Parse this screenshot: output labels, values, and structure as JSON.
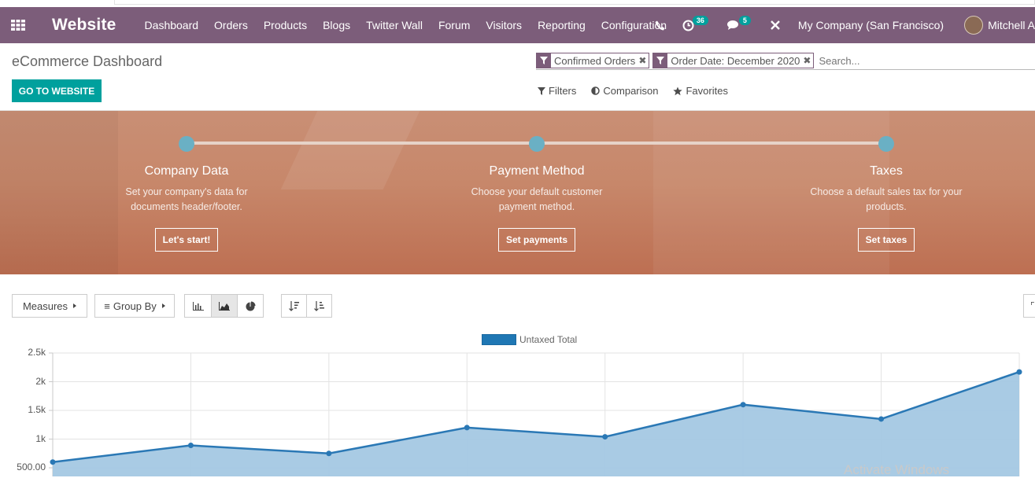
{
  "navbar": {
    "app_name": "Website",
    "menu": [
      "Dashboard",
      "Orders",
      "Products",
      "Blogs",
      "Twitter Wall",
      "Forum",
      "Visitors",
      "Reporting",
      "Configuration"
    ],
    "activity_count": "36",
    "message_count": "5",
    "company": "My Company (San Francisco)",
    "user": "Mitchell A"
  },
  "control_panel": {
    "breadcrumb": "eCommerce Dashboard",
    "go_button": "GO TO WEBSITE",
    "facets": [
      "Confirmed Orders",
      "Order Date: December 2020"
    ],
    "search_placeholder": "Search...",
    "options": [
      "Filters",
      "Comparison",
      "Favorites"
    ]
  },
  "onboarding": {
    "steps": [
      {
        "title": "Company Data",
        "desc1": "Set your company's data for",
        "desc2": "documents header/footer.",
        "button": "Let's start!"
      },
      {
        "title": "Payment Method",
        "desc1": "Choose your default customer",
        "desc2": "payment method.",
        "button": "Set payments"
      },
      {
        "title": "Taxes",
        "desc1": "Choose a default sales tax for your",
        "desc2": "products.",
        "button": "Set taxes"
      }
    ]
  },
  "graph_toolbar": {
    "measures": "Measures",
    "group_by": "Group By"
  },
  "watermark": "Activate Windows",
  "chart_data": {
    "type": "area",
    "series": [
      {
        "name": "Untaxed Total",
        "values": [
          600,
          890,
          750,
          1200,
          1040,
          1600,
          1350,
          2170
        ]
      }
    ],
    "x": [
      0,
      1,
      2,
      3,
      4,
      5,
      6,
      7
    ],
    "y_ticks": [
      "2.5k",
      "2k",
      "1.5k",
      "1k",
      "500.00"
    ],
    "ylim": [
      500,
      2500
    ],
    "grid": true,
    "legend": "top",
    "colors": {
      "line": "#2a78b5",
      "fill": "#a4c8e3"
    }
  }
}
